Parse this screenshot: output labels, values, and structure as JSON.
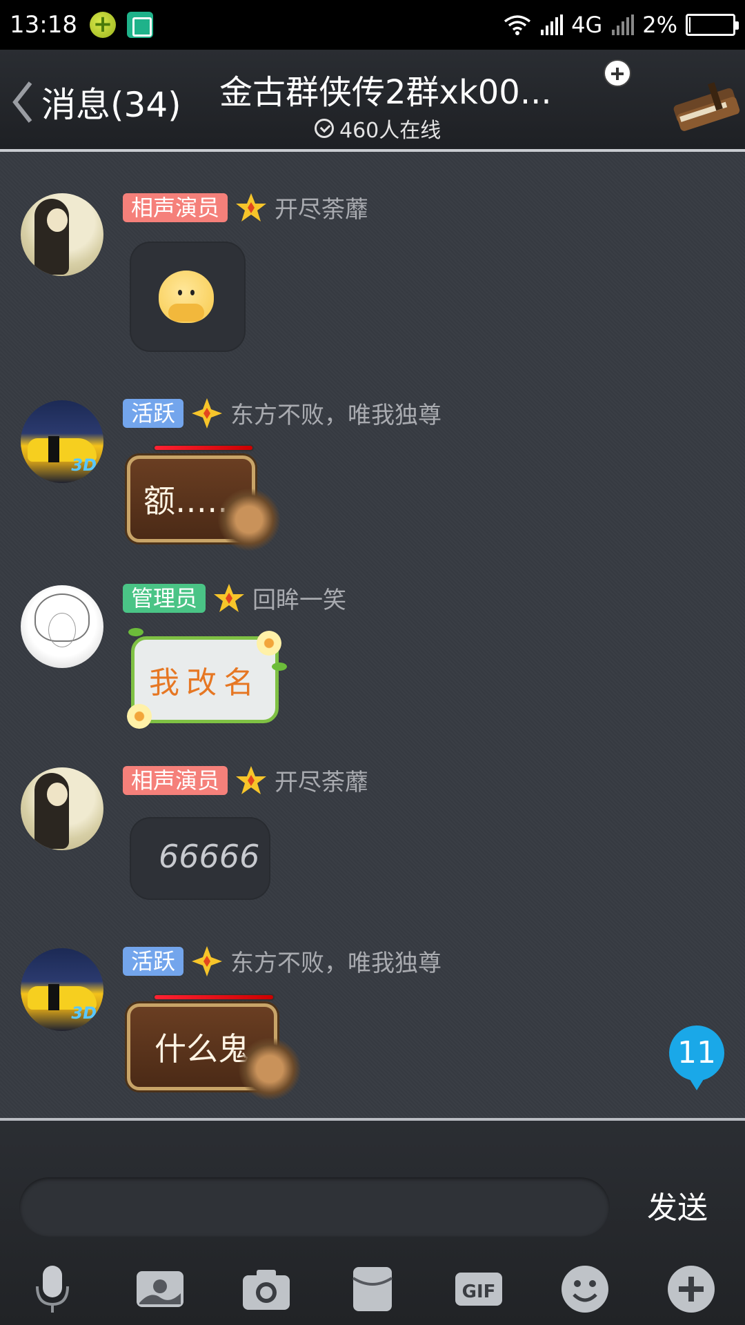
{
  "status_bar": {
    "time": "13:18",
    "network": "4G",
    "battery": "2%",
    "battery_level": 0.02
  },
  "header": {
    "back_label": "消息(34)",
    "title": "金古群侠传2群xk00...",
    "online": "460人在线"
  },
  "messages": [
    {
      "role": "相声演员",
      "role_color": "#f5807a",
      "nickname": "开尽荼蘼",
      "content_type": "emoji",
      "content": ""
    },
    {
      "role": "活跃",
      "role_color": "#73a5ec",
      "nickname": "东方不败，唯我独尊",
      "content_type": "text",
      "content": "额……"
    },
    {
      "role": "管理员",
      "role_color": "#4ac486",
      "nickname": "回眸一笑",
      "content_type": "text",
      "content": "我改名"
    },
    {
      "role": "相声演员",
      "role_color": "#f5807a",
      "nickname": "开尽荼蘼",
      "content_type": "text",
      "content": "66666"
    },
    {
      "role": "活跃",
      "role_color": "#73a5ec",
      "nickname": "东方不败，唯我独尊",
      "content_type": "text",
      "content": "什么鬼"
    }
  ],
  "unread_count": "11",
  "input": {
    "placeholder": "",
    "value": "",
    "send_label": "发送"
  },
  "toolbar": {
    "gif_label": "GIF",
    "icons": [
      "microphone-icon",
      "image-icon",
      "camera-icon",
      "red-packet-icon",
      "gif-icon",
      "emoji-icon",
      "plus-icon"
    ]
  }
}
